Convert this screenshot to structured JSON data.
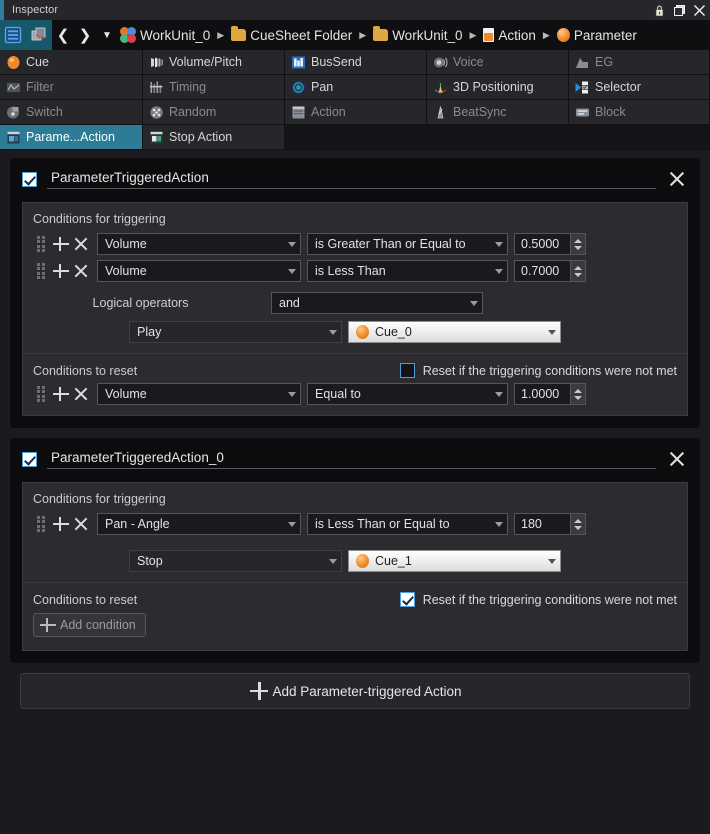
{
  "window": {
    "title": "Inspector",
    "controls": [
      {
        "name": "lock-icon",
        "label": "Lock"
      },
      {
        "name": "restore-icon",
        "label": "Restore"
      },
      {
        "name": "close-icon",
        "label": "Close"
      }
    ]
  },
  "breadcrumb": {
    "menu_icon": "list-icon",
    "link_icon": "link-refresh-icon",
    "back_icon": "chevron-left-icon",
    "forward_icon": "chevron-right-icon",
    "dropdown_icon": "chevron-down-icon",
    "items": [
      {
        "icon": "workunit-icon",
        "label": "WorkUnit_0"
      },
      {
        "icon": "folder-icon",
        "label": "CueSheet Folder"
      },
      {
        "icon": "folder-icon",
        "label": "WorkUnit_0"
      },
      {
        "icon": "action-doc-icon",
        "label": "Action"
      },
      {
        "icon": "cue-icon",
        "label": "Parameter"
      }
    ],
    "separator": "▶"
  },
  "tabs": {
    "rows": [
      [
        {
          "label": "Cue",
          "icon": "cue-icon",
          "state": "normal"
        },
        {
          "label": "Volume/Pitch",
          "icon": "volume-pitch-icon",
          "state": "normal"
        },
        {
          "label": "BusSend",
          "icon": "bussend-icon",
          "state": "normal"
        },
        {
          "label": "Voice",
          "icon": "voice-icon",
          "state": "dim"
        },
        {
          "label": "EG",
          "icon": "eg-icon",
          "state": "dim"
        }
      ],
      [
        {
          "label": "Filter",
          "icon": "filter-icon",
          "state": "dim"
        },
        {
          "label": "Timing",
          "icon": "timing-icon",
          "state": "dim"
        },
        {
          "label": "Pan",
          "icon": "pan-icon",
          "state": "normal"
        },
        {
          "label": "3D Positioning",
          "icon": "3d-positioning-icon",
          "state": "normal"
        },
        {
          "label": "Selector",
          "icon": "selector-icon",
          "state": "normal"
        }
      ],
      [
        {
          "label": "Switch",
          "icon": "switch-icon",
          "state": "dim"
        },
        {
          "label": "Random",
          "icon": "random-icon",
          "state": "dim"
        },
        {
          "label": "Action",
          "icon": "action-icon",
          "state": "dim"
        },
        {
          "label": "BeatSync",
          "icon": "beatsync-icon",
          "state": "dim"
        },
        {
          "label": "Block",
          "icon": "block-icon",
          "state": "dim"
        }
      ],
      [
        {
          "label": "Parame...Action",
          "icon": "parameter-action-icon",
          "state": "active"
        },
        {
          "label": "Stop Action",
          "icon": "stop-action-icon",
          "state": "normal"
        },
        {
          "label": "",
          "icon": "",
          "state": "filler"
        }
      ]
    ]
  },
  "actions": [
    {
      "enabled": true,
      "name": "ParameterTriggeredAction",
      "trigger": {
        "title": "Conditions for triggering",
        "conditions": [
          {
            "parameter": "Volume",
            "operator": "is Greater Than or Equal to",
            "value": "0.5000"
          },
          {
            "parameter": "Volume",
            "operator": "is Less Than",
            "value": "0.7000"
          }
        ],
        "logic_label": "Logical operators",
        "logic_value": "and",
        "action_value": "Play",
        "target_value": "Cue_0",
        "target_icon": "cue-icon"
      },
      "reset": {
        "title": "Conditions to reset",
        "reset_checkbox_label": "Reset if the triggering conditions were not met",
        "reset_checked": false,
        "conditions": [
          {
            "parameter": "Volume",
            "operator": "Equal to",
            "value": "1.0000"
          }
        ],
        "add_condition_label": ""
      }
    },
    {
      "enabled": true,
      "name": "ParameterTriggeredAction_0",
      "trigger": {
        "title": "Conditions for triggering",
        "conditions": [
          {
            "parameter": "Pan - Angle",
            "operator": "is Less Than or Equal to",
            "value": "180"
          }
        ],
        "logic_label": "",
        "logic_value": "",
        "action_value": "Stop",
        "target_value": "Cue_1",
        "target_icon": "cue-icon"
      },
      "reset": {
        "title": "Conditions to reset",
        "reset_checkbox_label": "Reset if the triggering conditions were not met",
        "reset_checked": true,
        "conditions": [],
        "add_condition_label": "Add condition"
      }
    }
  ],
  "footer": {
    "add_action_label": "Add Parameter-triggered Action"
  }
}
